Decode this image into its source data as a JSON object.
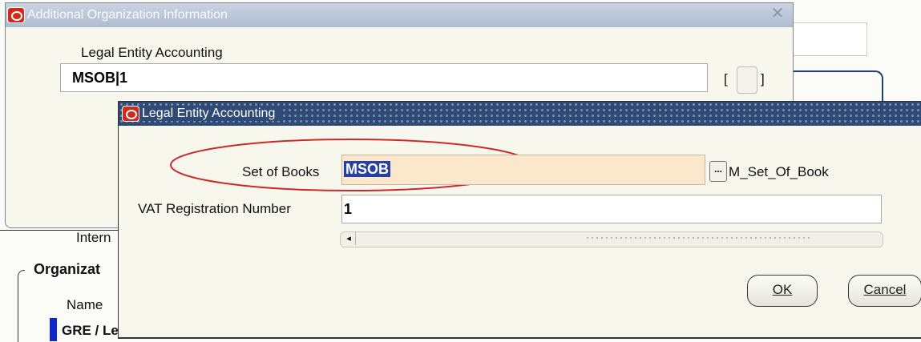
{
  "background": {
    "top_right_field_value": "",
    "tab_label": "Intern",
    "section_title": "Organizat",
    "name_label": "Name",
    "row_value": "GRE / Legal Entity"
  },
  "window_additional": {
    "title": "Additional Organization Information",
    "field_label": "Legal Entity Accounting",
    "field_value": "MSOB|1",
    "bracket_open": "[",
    "bracket_close": "]"
  },
  "window_legal": {
    "title": "Legal Entity Accounting",
    "set_of_books_label": "Set of Books",
    "set_of_books_value": "MSOB",
    "lov_button": "...",
    "lov_hint": "M_Set_Of_Book",
    "vat_label": "VAT Registration Number",
    "vat_value": "1",
    "scroll_left_glyph": "◂",
    "ok_label": "OK",
    "cancel_label": "Cancel"
  },
  "colors": {
    "annotation": "#cc2a2a",
    "selection": "#2740a8",
    "title_active": "#2e4a75"
  },
  "icons": {
    "app": "oracle-o-icon",
    "close": "close-icon"
  }
}
